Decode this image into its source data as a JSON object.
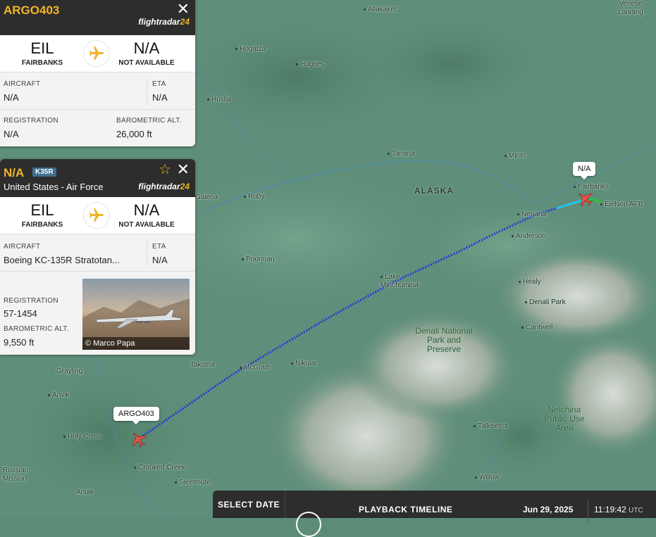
{
  "panel1": {
    "callsign": "ARGO403",
    "brand_a": "flightradar",
    "brand_b": "24",
    "origin_code": "EIL",
    "origin_city": "FAIRBANKS",
    "dest_code": "N/A",
    "dest_city": "NOT AVAILABLE",
    "aircraft_label": "AIRCRAFT",
    "aircraft_value": "N/A",
    "eta_label": "ETA",
    "eta_value": "N/A",
    "registration_label": "REGISTRATION",
    "registration_value": "N/A",
    "baro_label": "BAROMETRIC ALT.",
    "baro_value": "26,000 ft"
  },
  "panel2": {
    "callsign": "N/A",
    "type_badge": "K35R",
    "operator": "United States - Air Force",
    "brand_a": "flightradar",
    "brand_b": "24",
    "origin_code": "EIL",
    "origin_city": "FAIRBANKS",
    "dest_code": "N/A",
    "dest_city": "NOT AVAILABLE",
    "aircraft_label": "AIRCRAFT",
    "aircraft_value": "Boeing KC-135R Stratotan...",
    "eta_label": "ETA",
    "eta_value": "N/A",
    "registration_label": "REGISTRATION",
    "registration_value": "57-1454",
    "baro_label": "BAROMETRIC ALT.",
    "baro_value": "9,550 ft",
    "photo_credit": "© Marco Papa"
  },
  "map": {
    "callout_argo": "ARGO403",
    "callout_na": "N/A",
    "region": "ALASKA",
    "park1": "Denali National Park and Preserve",
    "park2": "Nelchina Public Use Area",
    "places": [
      "Allakaket",
      "Venetie Landing",
      "Hogatza",
      "Hughes",
      "Huslia",
      "Tanana",
      "Minto",
      "Fairbanks",
      "Eielson AFB",
      "Nenana",
      "Anderson",
      "Galena",
      "Ruby",
      "Poorman",
      "Lake Minchumina",
      "Healy",
      "Denali Park",
      "Cantwell",
      "Takotna",
      "McGrath",
      "Nikolai",
      "Grayling",
      "Anvik",
      "Holy Cross",
      "Crooked Creek",
      "Sleetmute",
      "Russian Mission",
      "Aniak",
      "Talkeetna",
      "Willow"
    ]
  },
  "bottombar": {
    "select_date": "SELECT DATE",
    "playback": "PLAYBACK TIMELINE",
    "date": "Jun 29, 2025",
    "time": "11:19:42",
    "tz": "UTC"
  },
  "colors": {
    "accent": "#f0b429",
    "track_blue": "#2233dd",
    "track_cyan": "#22c6e8",
    "track_green": "#22cc33",
    "plane": "#e8524a"
  }
}
